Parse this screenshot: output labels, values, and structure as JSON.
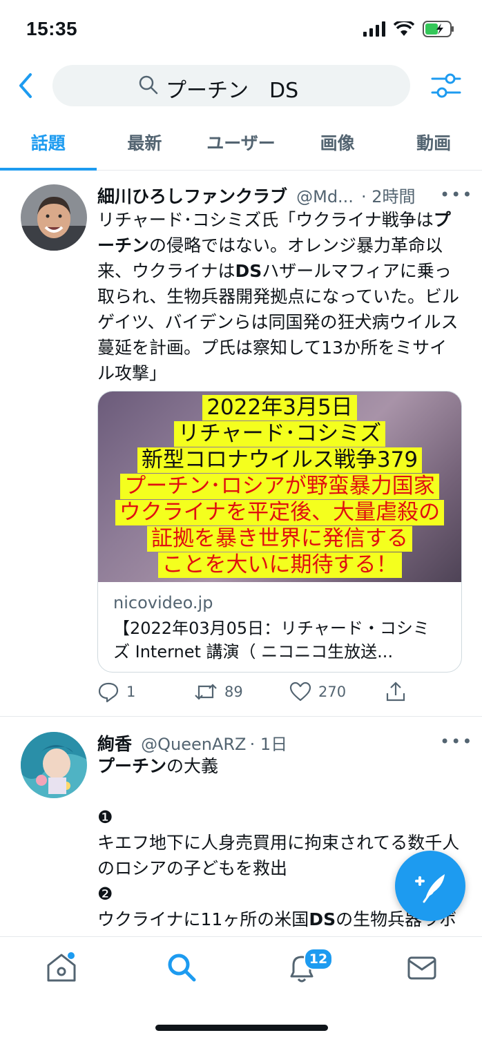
{
  "status_bar": {
    "time": "15:35"
  },
  "search": {
    "query": "プーチン　DS"
  },
  "tabs": [
    {
      "label": "話題",
      "active": true
    },
    {
      "label": "最新",
      "active": false
    },
    {
      "label": "ユーザー",
      "active": false
    },
    {
      "label": "画像",
      "active": false
    },
    {
      "label": "動画",
      "active": false
    }
  ],
  "tweets": [
    {
      "name": "細川ひろしファンクラブ",
      "handle": "@Md...",
      "time": "· 2時間",
      "more": "•••",
      "body_segments": [
        {
          "text": "リチャード･コシミズ氏「ウクライナ戦争は"
        },
        {
          "text": "プーチン",
          "bold": true
        },
        {
          "text": "の侵略ではない。オレンジ暴力革命以来、ウクライナは"
        },
        {
          "text": "DS",
          "bold": true
        },
        {
          "text": "ハザールマフィアに乗っ取られ、生物兵器開発拠点になっていた。ビルゲイツ、バイデンらは同国発の狂犬病ウイルス蔓延を計画。プ氏は察知して13か所をミサイル攻撃」"
        }
      ],
      "card": {
        "image_lines": [
          {
            "text": "2022年3月5日",
            "color": "black"
          },
          {
            "text": "リチャード･コシミズ",
            "color": "black"
          },
          {
            "text": "新型コロナウイルス戦争379",
            "color": "black"
          },
          {
            "text": "プーチン･ロシアが野蛮暴力国家",
            "color": "red"
          },
          {
            "text": "ウクライナを平定後、大量虐殺の",
            "color": "red"
          },
          {
            "text": "証拠を暴き世界に発信する",
            "color": "red"
          },
          {
            "text": "ことを大いに期待する！",
            "color": "red"
          }
        ],
        "domain": "nicovideo.jp",
        "title": "【2022年03月05日：リチャード・コシミズ Internet 講演（ ニコニコ生放送..."
      },
      "actions": {
        "replies": "1",
        "retweets": "89",
        "likes": "270"
      }
    },
    {
      "name": "絢香",
      "handle": "@QueenARZ",
      "time": "· 1日",
      "more": "•••",
      "lines": [
        {
          "segments": [
            {
              "text": "プーチン",
              "bold": true
            },
            {
              "text": "の大義"
            }
          ]
        },
        {
          "segments": [
            {
              "text": " "
            }
          ]
        },
        {
          "segments": [
            {
              "text": "❶"
            }
          ]
        },
        {
          "segments": [
            {
              "text": "キエフ地下に人身売買用に拘束されてる数千人のロシアの子どもを救出"
            }
          ]
        },
        {
          "segments": [
            {
              "text": "❷"
            }
          ]
        },
        {
          "segments": [
            {
              "text": "ウクライナに11ヶ所の米国"
            },
            {
              "text": "DS",
              "bold": true
            },
            {
              "text": "の生物兵器ラボを粉砕"
            }
          ]
        }
      ]
    }
  ],
  "bottom_nav": {
    "items": [
      "home",
      "search",
      "notifications",
      "messages"
    ],
    "notification_badge": "12"
  },
  "colors": {
    "accent": "#1d9bf0",
    "text": "#0f1419",
    "secondary": "#536471",
    "banner_yellow": "#f4ff1e",
    "banner_red": "#e01010"
  }
}
